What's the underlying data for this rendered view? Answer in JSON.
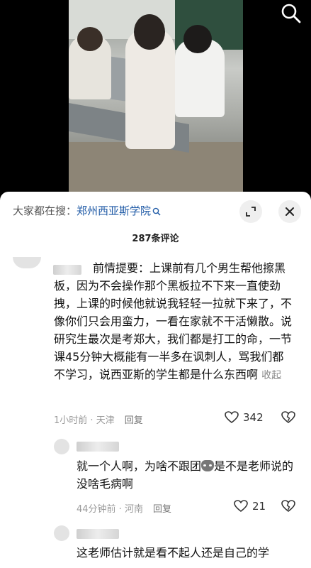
{
  "header": {
    "search_prefix": "大家都在搜：",
    "search_keyword": "郑州西亚斯学院"
  },
  "comment_count": "287条评论",
  "comments": [
    {
      "text": "前情提要：上课前有几个男生帮他擦黑板，因为不会操作那个黑板拉不下来一直使劲拽，上课的时候他就说我轻轻一拉就下来了，不像你们只会用蛮力，一看在家就不干活懒散。说研究生最次是考郑大，我们都是打工的命，一节课45分钟大概能有一半多在讽刺人，骂我们都不学习，说西亚斯的学生都是什么东西啊",
      "collapse": "收起",
      "time": "1小时前",
      "location": "天津",
      "reply": "回复",
      "likes": "342"
    },
    {
      "text_a": "就一个人啊，为啥不跟团",
      "text_b": "是不是老师说的没啥毛病啊",
      "time": "44分钟前",
      "location": "河南",
      "reply": "回复",
      "likes": "21"
    },
    {
      "text": "这老师估计就是看不起人还是自己的学"
    }
  ],
  "icons": {
    "search": "search-icon",
    "expand": "expand-icon",
    "close": "close-icon",
    "like": "heart-icon",
    "dislike": "broken-heart-icon",
    "emoji": "dog-face-emoji-icon"
  }
}
